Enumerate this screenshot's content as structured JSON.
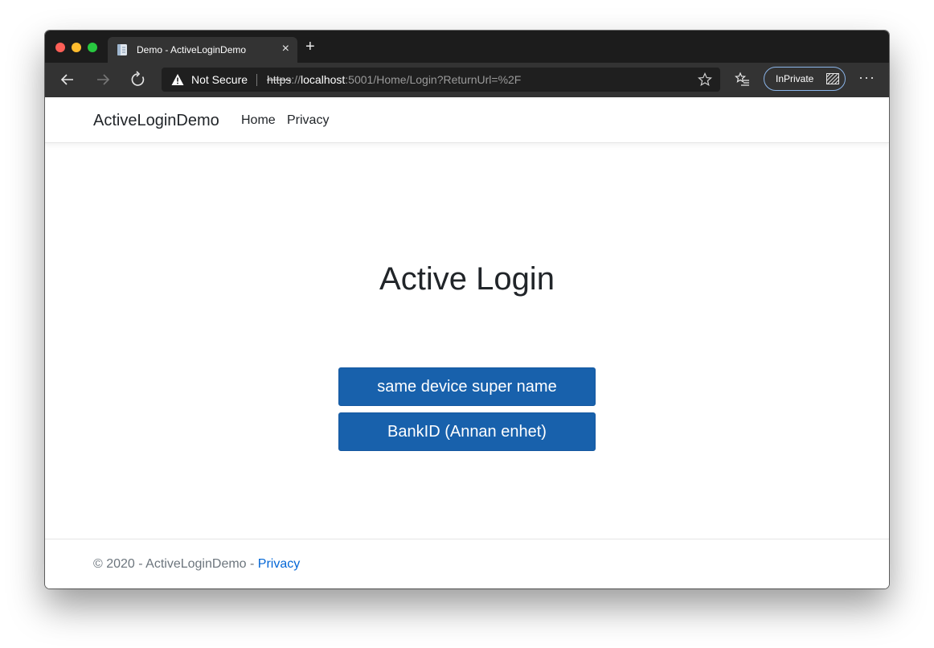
{
  "browser": {
    "tab": {
      "title": "Demo - ActiveLoginDemo",
      "close_glyph": "×"
    },
    "new_tab_glyph": "+",
    "address": {
      "security_label": "Not Secure",
      "url_scheme": "https",
      "url_separator": "://",
      "url_host": "localhost",
      "url_rest": ":5001/Home/Login?ReturnUrl=%2F"
    },
    "inprivate_label": "InPrivate",
    "more_glyph": "···"
  },
  "site": {
    "brand": "ActiveLoginDemo",
    "nav": {
      "home": "Home",
      "privacy": "Privacy"
    }
  },
  "main": {
    "title": "Active Login",
    "buttons": {
      "same_device": "same device super name",
      "other_device": "BankID (Annan enhet)"
    }
  },
  "footer": {
    "copyright": "© 2020 - ActiveLoginDemo - ",
    "privacy_link": "Privacy"
  },
  "colors": {
    "primary_button": "#1861ac",
    "link": "#0366d6",
    "chrome_dark": "#1c1c1c",
    "toolbar": "#333333"
  }
}
